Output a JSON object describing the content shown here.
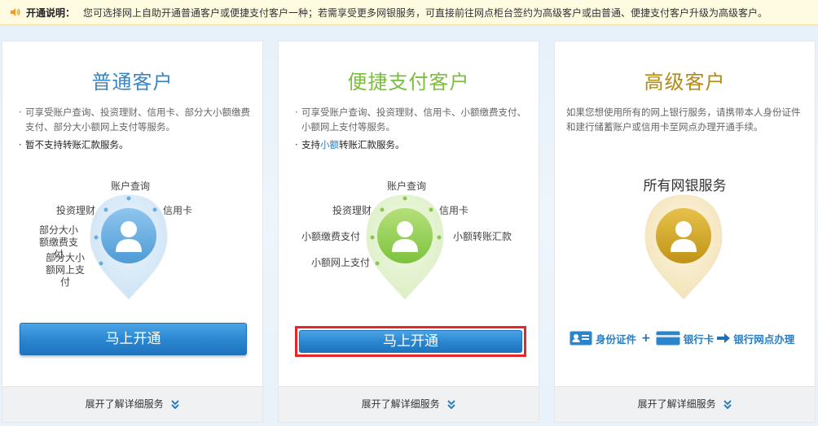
{
  "notice": {
    "title": "开通说明：",
    "text": "您可选择网上自助开通普通客户或便捷支付客户一种；若需享受更多网银服务，可直接前往网点柜台签约为高级客户或由普通、便捷支付客户升级为高级客户。"
  },
  "cards": [
    {
      "title": "普通客户",
      "desc_lines": [
        "可享受账户查询、投资理财、信用卡、部分大小额缴费支付、部分大小额网上支付等服务。"
      ],
      "desc_emphasis": "暂不支持转账汇款服务。",
      "services": [
        "账户查询",
        "投资理财",
        "信用卡",
        "部分大小额缴费支付",
        "部分大小额网上支付"
      ],
      "button": "马上开通",
      "footer": "展开了解详细服务"
    },
    {
      "title": "便捷支付客户",
      "desc_lines": [
        "可享受账户查询、投资理财、信用卡、小额缴费支付、小额网上支付等服务。"
      ],
      "desc_emphasis_pre": "支持",
      "desc_emphasis_hl": "小额",
      "desc_emphasis_post": "转账汇款服务。",
      "services": [
        "账户查询",
        "投资理财",
        "信用卡",
        "小额缴费支付",
        "小额转账汇款",
        "小额网上支付"
      ],
      "button": "马上开通",
      "footer": "展开了解详细服务"
    },
    {
      "title": "高级客户",
      "desc": "如果您想使用所有的网上银行服务，请携带本人身份证件和建行储蓄账户或信用卡至网点办理开通手续。",
      "services_title": "所有网银服务",
      "flow": [
        "身份证件",
        "+",
        "银行卡",
        "银行网点办理"
      ],
      "footer": "展开了解详细服务"
    }
  ],
  "colors": {
    "regular": "#3a86c5",
    "convenient": "#7bbd3c",
    "premium": "#b48a12",
    "button": "#2a85cf",
    "highlight_border": "#e8262a"
  },
  "icons": [
    "speaker-icon",
    "user-avatar-icon",
    "id-card-icon",
    "bank-card-icon",
    "arrow-right-icon",
    "double-chevron-down-icon"
  ]
}
